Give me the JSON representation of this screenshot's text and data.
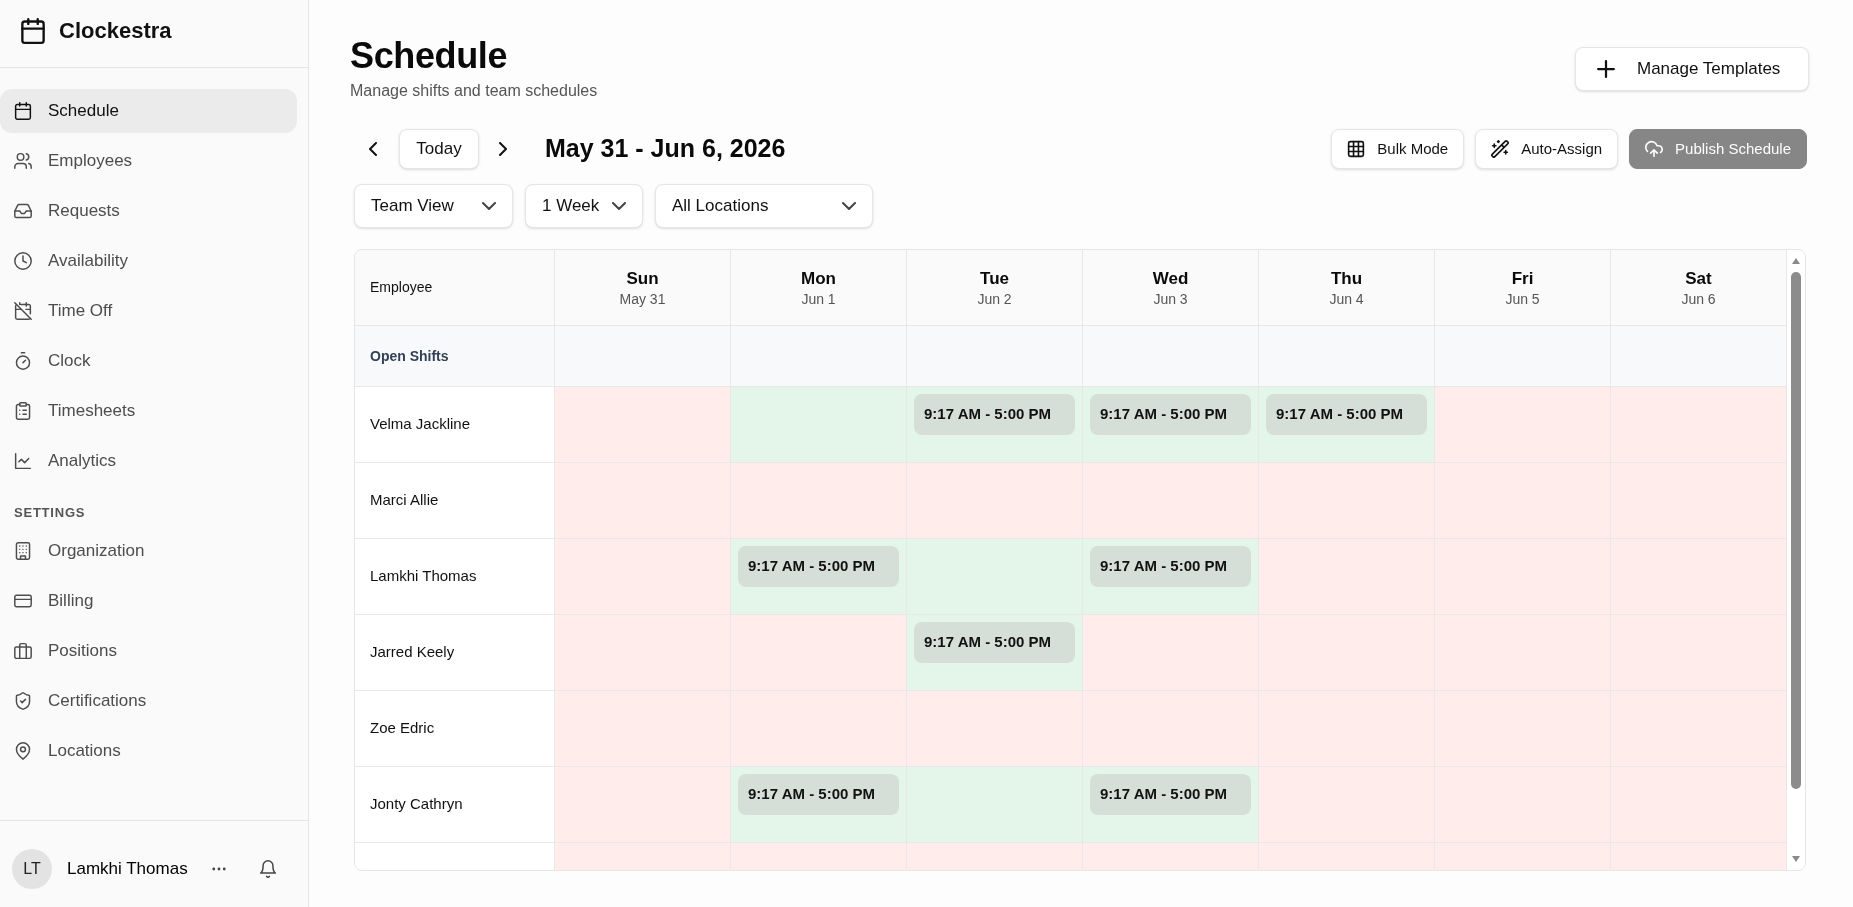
{
  "sidebar": {
    "brand": "Clockestra",
    "nav": [
      {
        "label": "Schedule",
        "selected": true
      },
      {
        "label": "Employees",
        "selected": false
      },
      {
        "label": "Requests",
        "selected": false
      },
      {
        "label": "Availability",
        "selected": false
      },
      {
        "label": "Time Off",
        "selected": false
      },
      {
        "label": "Clock",
        "selected": false
      },
      {
        "label": "Timesheets",
        "selected": false
      },
      {
        "label": "Analytics",
        "selected": false
      }
    ],
    "settings_heading": "SETTINGS",
    "settings_nav": [
      {
        "label": "Organization",
        "selected": false
      },
      {
        "label": "Billing",
        "selected": false
      },
      {
        "label": "Positions",
        "selected": false
      },
      {
        "label": "Certifications",
        "selected": false
      },
      {
        "label": "Locations",
        "selected": false
      }
    ],
    "user": {
      "initials": "LT",
      "name": "Lamkhi Thomas"
    }
  },
  "header": {
    "title": "Schedule",
    "subtitle": "Manage shifts and team schedules",
    "templates_button": "Manage Templates"
  },
  "toolbar": {
    "today_button": "Today",
    "date_range": "May 31 - Jun 6, 2026",
    "actions": [
      {
        "label": "Bulk Mode",
        "kind": "outline",
        "disabled": false
      },
      {
        "label": "Auto-Assign",
        "kind": "outline",
        "disabled": false
      },
      {
        "label": "Publish Schedule",
        "kind": "primary",
        "disabled": true
      }
    ],
    "filters": [
      {
        "value": "Team View"
      },
      {
        "value": "1 Week"
      },
      {
        "value": "All Locations"
      }
    ]
  },
  "schedule": {
    "employee_column": "Employee",
    "days": [
      {
        "day": "Sun",
        "date": "May 31"
      },
      {
        "day": "Mon",
        "date": "Jun 1"
      },
      {
        "day": "Tue",
        "date": "Jun 2"
      },
      {
        "day": "Wed",
        "date": "Jun 3"
      },
      {
        "day": "Thu",
        "date": "Jun 4"
      },
      {
        "day": "Fri",
        "date": "Jun 5"
      },
      {
        "day": "Sat",
        "date": "Jun 6"
      }
    ],
    "open_shifts_label": "Open Shifts",
    "rows": [
      {
        "name": "Velma Jackline",
        "cells": [
          {
            "available": false
          },
          {
            "available": true
          },
          {
            "available": true,
            "shifts": [
              "9:17 AM - 5:00 PM"
            ]
          },
          {
            "available": true,
            "shifts": [
              "9:17 AM - 5:00 PM"
            ]
          },
          {
            "available": true,
            "shifts": [
              "9:17 AM - 5:00 PM"
            ]
          },
          {
            "available": false
          },
          {
            "available": false
          }
        ]
      },
      {
        "name": "Marci Allie",
        "cells": [
          {
            "available": false
          },
          {
            "available": false
          },
          {
            "available": false
          },
          {
            "available": false
          },
          {
            "available": false
          },
          {
            "available": false
          },
          {
            "available": false
          }
        ]
      },
      {
        "name": "Lamkhi Thomas",
        "cells": [
          {
            "available": false
          },
          {
            "available": true,
            "shifts": [
              "9:17 AM - 5:00 PM"
            ]
          },
          {
            "available": true
          },
          {
            "available": true,
            "shifts": [
              "9:17 AM - 5:00 PM"
            ]
          },
          {
            "available": false
          },
          {
            "available": false
          },
          {
            "available": false
          }
        ]
      },
      {
        "name": "Jarred Keely",
        "cells": [
          {
            "available": false
          },
          {
            "available": false
          },
          {
            "available": true,
            "shifts": [
              "9:17 AM - 5:00 PM"
            ]
          },
          {
            "available": false
          },
          {
            "available": false
          },
          {
            "available": false
          },
          {
            "available": false
          }
        ]
      },
      {
        "name": "Zoe Edric",
        "cells": [
          {
            "available": false
          },
          {
            "available": false
          },
          {
            "available": false
          },
          {
            "available": false
          },
          {
            "available": false
          },
          {
            "available": false
          },
          {
            "available": false
          }
        ]
      },
      {
        "name": "Jonty Cathryn",
        "cells": [
          {
            "available": false
          },
          {
            "available": true,
            "shifts": [
              "9:17 AM - 5:00 PM"
            ]
          },
          {
            "available": true
          },
          {
            "available": true,
            "shifts": [
              "9:17 AM - 5:00 PM"
            ]
          },
          {
            "available": false
          },
          {
            "available": false
          },
          {
            "available": false
          }
        ]
      },
      {
        "cells": [
          {
            "available": false
          },
          {
            "available": false
          },
          {
            "available": false
          },
          {
            "available": false
          },
          {
            "available": false
          },
          {
            "available": false
          },
          {
            "available": false
          }
        ]
      }
    ]
  }
}
